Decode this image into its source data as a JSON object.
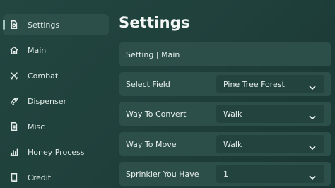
{
  "sidebar": {
    "items": [
      {
        "label": "Settings",
        "icon": "settings-icon",
        "active": true
      },
      {
        "label": "Main",
        "icon": "home-icon"
      },
      {
        "label": "Combat",
        "icon": "swords-icon"
      },
      {
        "label": "Dispenser",
        "icon": "rocket-icon"
      },
      {
        "label": "Misc",
        "icon": "document-icon"
      },
      {
        "label": "Honey Process",
        "icon": "bar-chart-icon"
      },
      {
        "label": "Credit",
        "icon": "book-icon"
      }
    ]
  },
  "main": {
    "title": "Settings",
    "section_header": "Setting | Main",
    "rows": [
      {
        "label": "Select Field",
        "value": "Pine Tree Forest"
      },
      {
        "label": "Way To Convert",
        "value": "Walk"
      },
      {
        "label": "Way To Move",
        "value": "Walk"
      },
      {
        "label": "Sprinkler You Have",
        "value": "1"
      }
    ]
  },
  "colors": {
    "background": "#1f403b",
    "panel": "#2c4f4a",
    "dropdown": "#23433f",
    "text": "#e8f0ee"
  }
}
